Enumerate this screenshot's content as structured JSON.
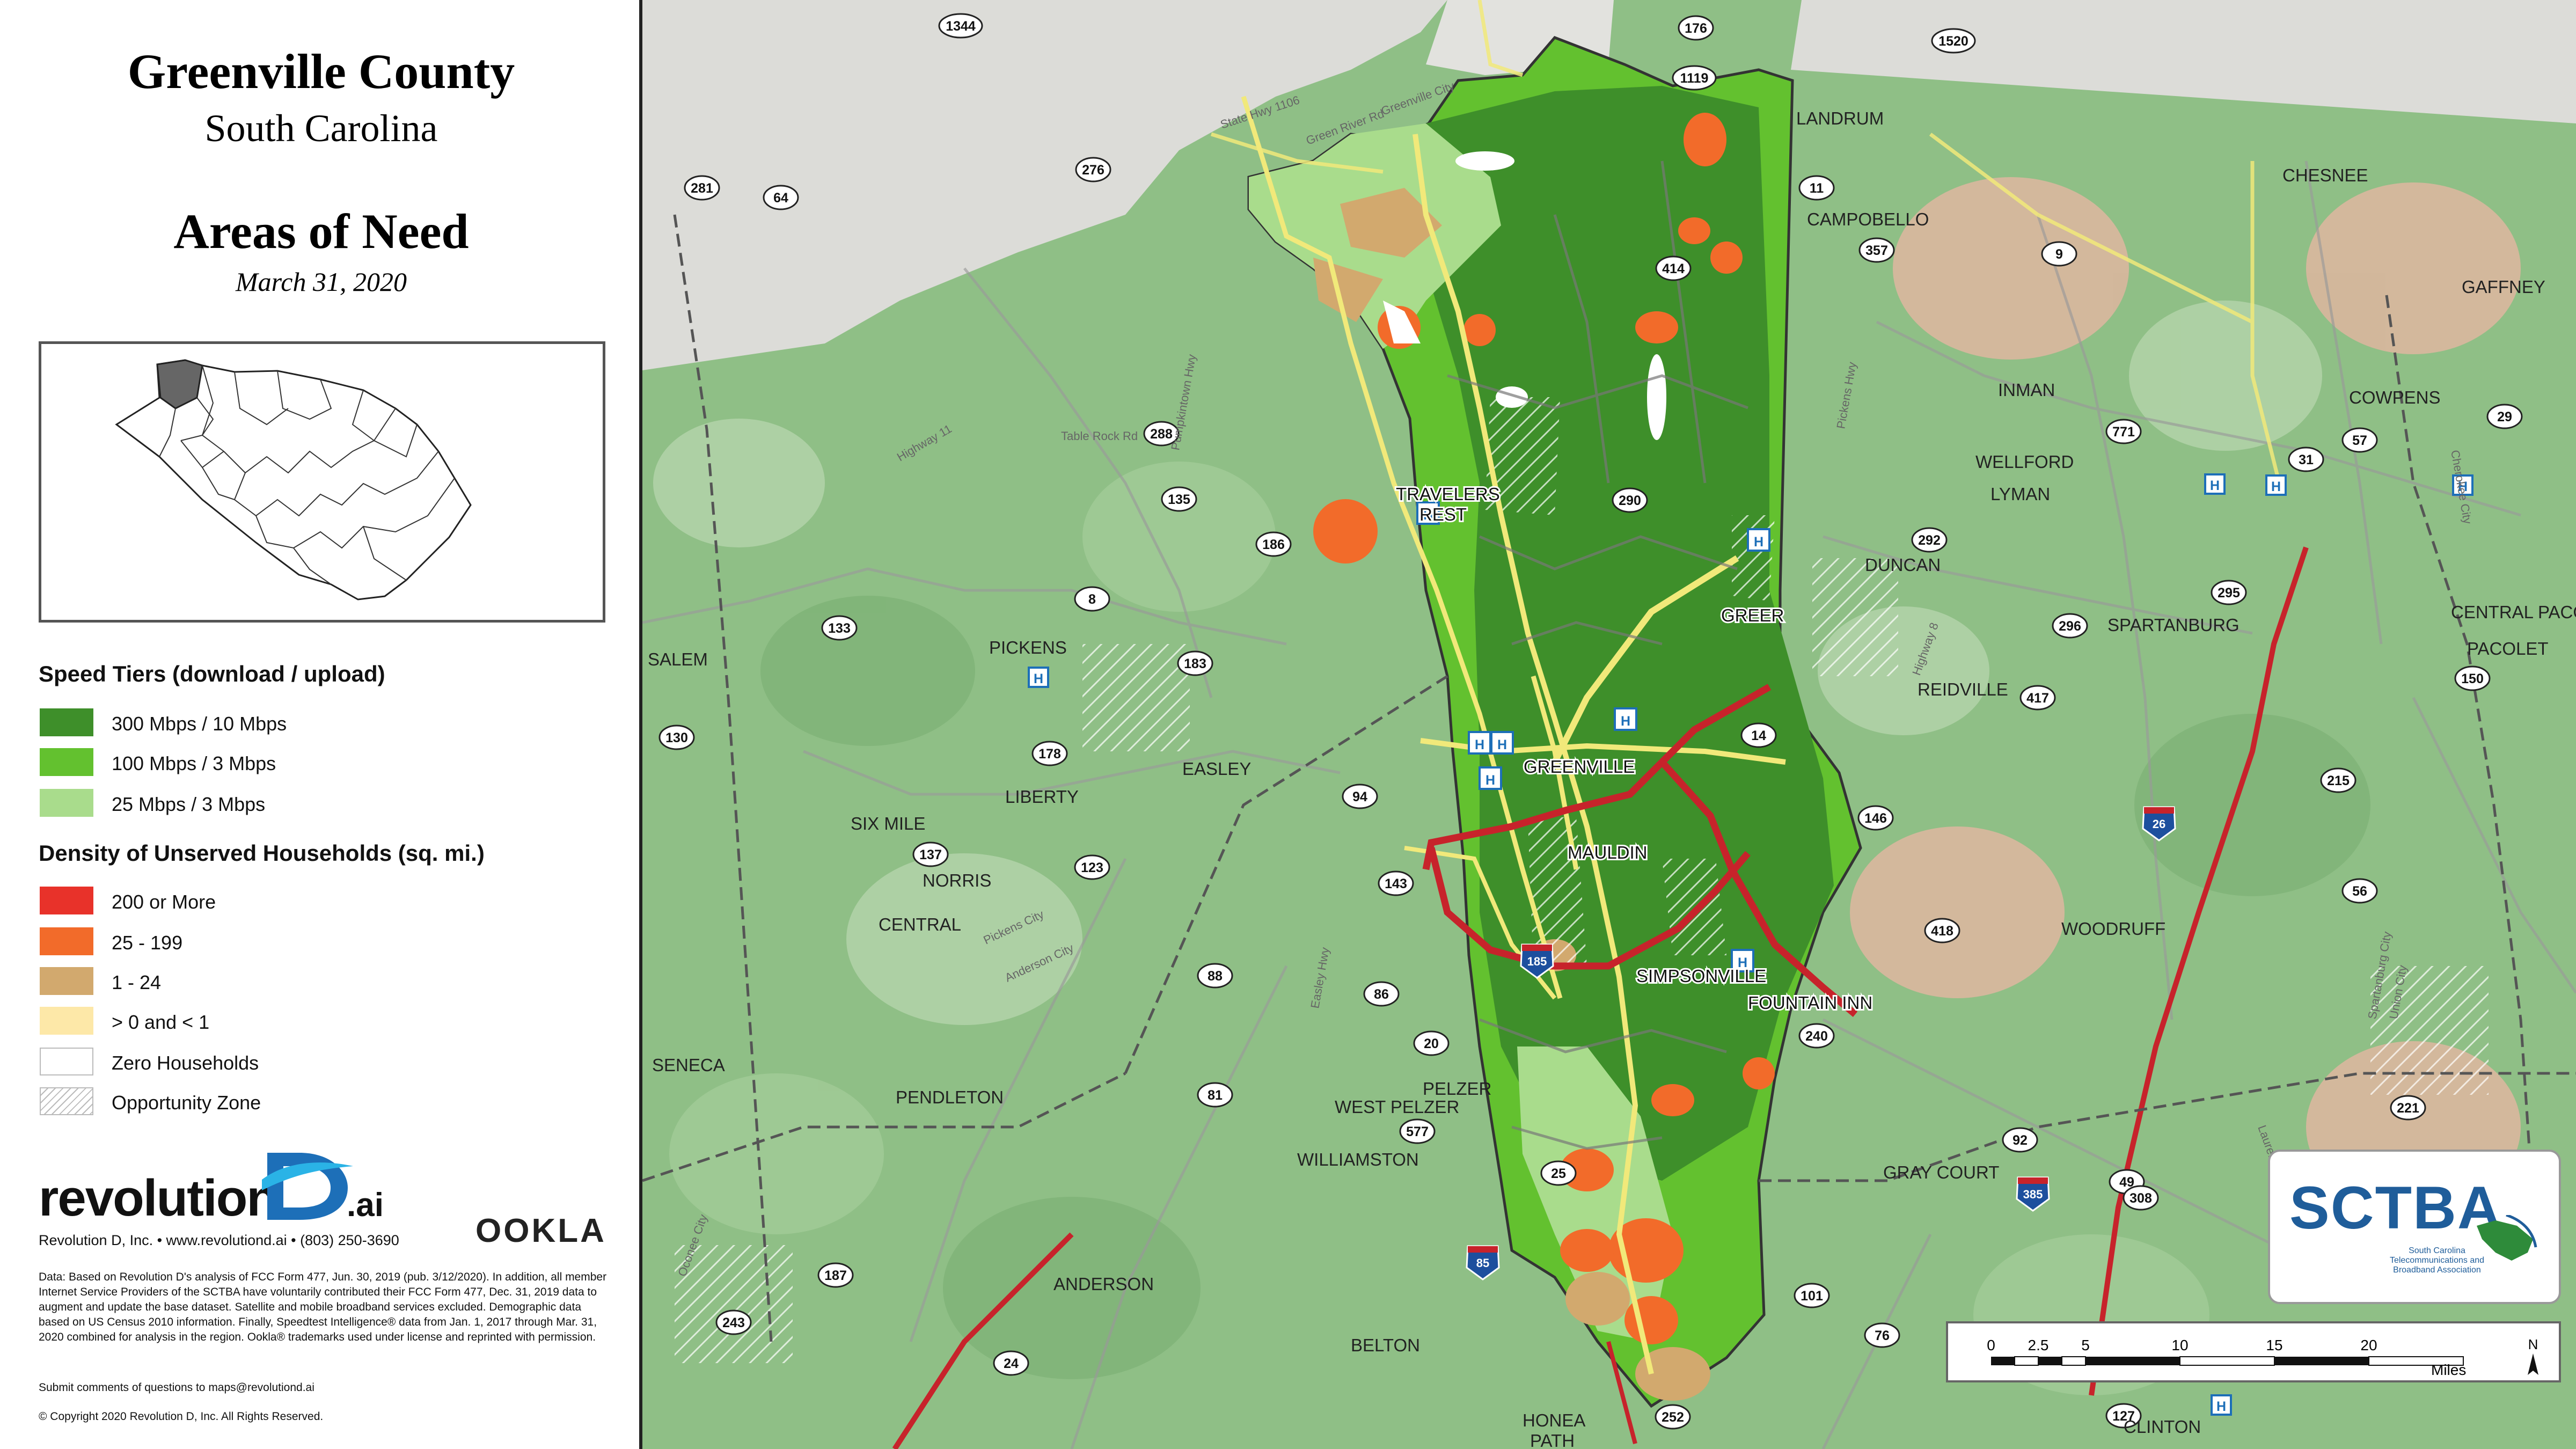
{
  "title": "Greenville County",
  "subtitle": "South Carolina",
  "map_title": "Areas of Need",
  "date": "March 31, 2020",
  "legend": {
    "speed_heading": "Speed Tiers (download / upload)",
    "speed_tiers": [
      {
        "label": "300 Mbps / 10 Mbps",
        "color": "#3e8f2a"
      },
      {
        "label": "100 Mbps / 3 Mbps",
        "color": "#63c12f"
      },
      {
        "label": "25 Mbps / 3 Mbps",
        "color": "#a9dc8c"
      }
    ],
    "density_heading": "Density of Unserved Households (sq. mi.)",
    "density_classes": [
      {
        "label": "200 or More",
        "color": "#e8322a"
      },
      {
        "label": "25 - 199",
        "color": "#f26b2a"
      },
      {
        "label": "1 - 24",
        "color": "#d2a96e"
      },
      {
        "label": "> 0 and < 1",
        "color": "#fde8a8"
      },
      {
        "label": "Zero Households",
        "color": "#ffffff"
      },
      {
        "label": "Opportunity Zone",
        "color": "hatch"
      }
    ]
  },
  "branding": {
    "logo_word": "revolution",
    "logo_suffix": ".ai",
    "logo_line": "Revolution D, Inc. • www.revolutiond.ai • (803) 250-3690",
    "ookla": "OOKLA",
    "sctba_name": "SCTBA",
    "sctba_sub": "South Carolina Telecommunications and Broadband Association"
  },
  "disclaimer": "Data: Based on Revolution D's analysis of FCC Form 477, Jun. 30, 2019 (pub. 3/12/2020). In addition, all member Internet Service Providers of the SCTBA have voluntarily contributed their FCC Form 477, Dec. 31, 2019 data to augment and update the base dataset. Satellite and mobile broadband services excluded. Demographic data based on US Census 2010 information. Finally, Speedtest Intelligence® data from Jan. 1, 2017 through Mar. 31, 2020 combined for analysis in the region. Ookla® trademarks used under license and reprinted with permission.",
  "submit": "Submit comments of questions to maps@revolutiond.ai",
  "copyright": "© Copyright 2020 Revolution D, Inc. All Rights Reserved.",
  "scale": {
    "ticks": [
      "0",
      "2.5",
      "5",
      "10",
      "15",
      "20"
    ],
    "unit": "Miles",
    "north": "N"
  },
  "places": {
    "landrum": "LANDRUM",
    "campobello": "CAMPOBELLO",
    "chesnee": "CHESNEE",
    "gaffney": "GAFFNEY",
    "inman": "INMAN",
    "wellford": "WELLFORD",
    "lyman": "LYMAN",
    "cowpens": "COWPENS",
    "duncan": "DUNCAN",
    "spartanburg": "SPARTANBURG",
    "central_pacolet": "CENTRAL PACOLET",
    "pacolet": "PACOLET",
    "greer": "GREER",
    "reidville": "REIDVILLE",
    "travelers": "TRAVELERS",
    "rest": "REST",
    "greenville": "GREENVILLE",
    "mauldin": "MAULDIN",
    "woodruff": "WOODRUFF",
    "simpsonville": "SIMPSONVILLE",
    "fountain_inn": "FOUNTAIN INN",
    "salem": "SALEM",
    "pickens": "PICKENS",
    "easley": "EASLEY",
    "liberty": "LIBERTY",
    "six_mile": "SIX MILE",
    "norris": "NORRIS",
    "central": "CENTRAL",
    "seneca": "SENECA",
    "pendleton": "PENDLETON",
    "pelzer": "PELZER",
    "west_pelzer": "WEST PELZER",
    "williamston": "WILLIAMSTON",
    "anderson": "ANDERSON",
    "belton": "BELTON",
    "honea": "HONEA",
    "path": "PATH",
    "gray_court": "GRAY COURT",
    "clinton": "CLINTON"
  },
  "route_shields": [
    "1344",
    "176",
    "1119",
    "1520",
    "281",
    "64",
    "276",
    "414",
    "11",
    "357",
    "9",
    "771",
    "31",
    "57",
    "29",
    "288",
    "135",
    "290",
    "186",
    "8",
    "292",
    "295",
    "133",
    "183",
    "130",
    "296",
    "417",
    "150",
    "14",
    "178",
    "94",
    "146",
    "215",
    "137",
    "123",
    "143",
    "418",
    "56",
    "88",
    "86",
    "20",
    "240",
    "81",
    "577",
    "25",
    "92",
    "221",
    "49",
    "385",
    "187",
    "85",
    "308",
    "243",
    "101",
    "76",
    "24",
    "252",
    "127",
    "26",
    "185"
  ],
  "road_labels": [
    "Greenville City",
    "State Hwy 1106",
    "Green River Rd",
    "Table Rock Rd",
    "Pumpkintown Hwy",
    "Highway 11",
    "Pickens Hwy",
    "Highway 8",
    "Easley Hwy",
    "Anderson City",
    "Pickens City",
    "Spartanburg City",
    "Union City",
    "Laurens City",
    "Cherokee City",
    "Oconee City"
  ]
}
